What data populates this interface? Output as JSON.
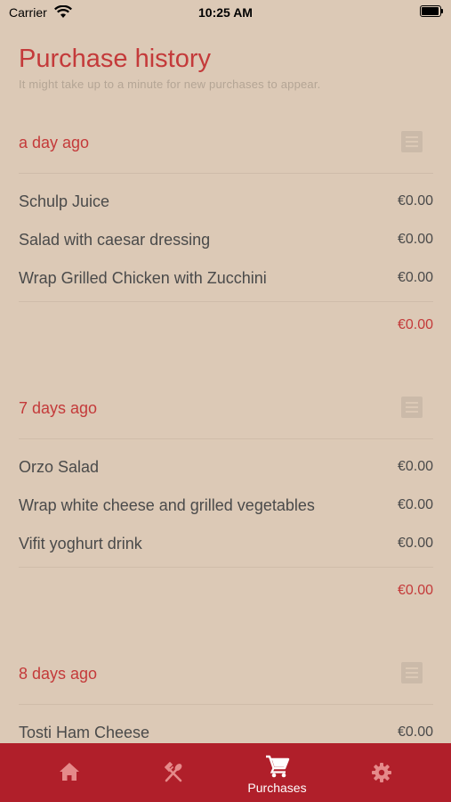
{
  "status_bar": {
    "carrier": "Carrier",
    "time": "10:25 AM"
  },
  "header": {
    "title": "Purchase history",
    "subtitle": "It might take up to a minute for new purchases to appear."
  },
  "purchases": [
    {
      "date": "a day ago",
      "items": [
        {
          "name": "Schulp Juice",
          "price": "€0.00"
        },
        {
          "name": "Salad with caesar dressing",
          "price": "€0.00"
        },
        {
          "name": "Wrap Grilled Chicken with Zucchini",
          "price": "€0.00"
        }
      ],
      "total": "€0.00"
    },
    {
      "date": "7 days ago",
      "items": [
        {
          "name": "Orzo Salad",
          "price": "€0.00"
        },
        {
          "name": "Wrap white cheese and grilled vegetables",
          "price": "€0.00"
        },
        {
          "name": "Vifit yoghurt drink",
          "price": "€0.00"
        }
      ],
      "total": "€0.00"
    },
    {
      "date": "8 days ago",
      "items": [
        {
          "name": "Tosti Ham Cheese",
          "price": "€0.00"
        }
      ]
    }
  ],
  "tab_bar": {
    "tabs": [
      {
        "icon": "home-icon"
      },
      {
        "icon": "fork-spoon-icon"
      },
      {
        "icon": "cart-icon",
        "label": "Purchases",
        "selected": true
      },
      {
        "icon": "gear-icon"
      }
    ]
  },
  "colors": {
    "background": "#dcc9b6",
    "accent": "#c43a3a",
    "tab_bar": "#b01f2a",
    "icon_muted": "#cbbaa9"
  }
}
